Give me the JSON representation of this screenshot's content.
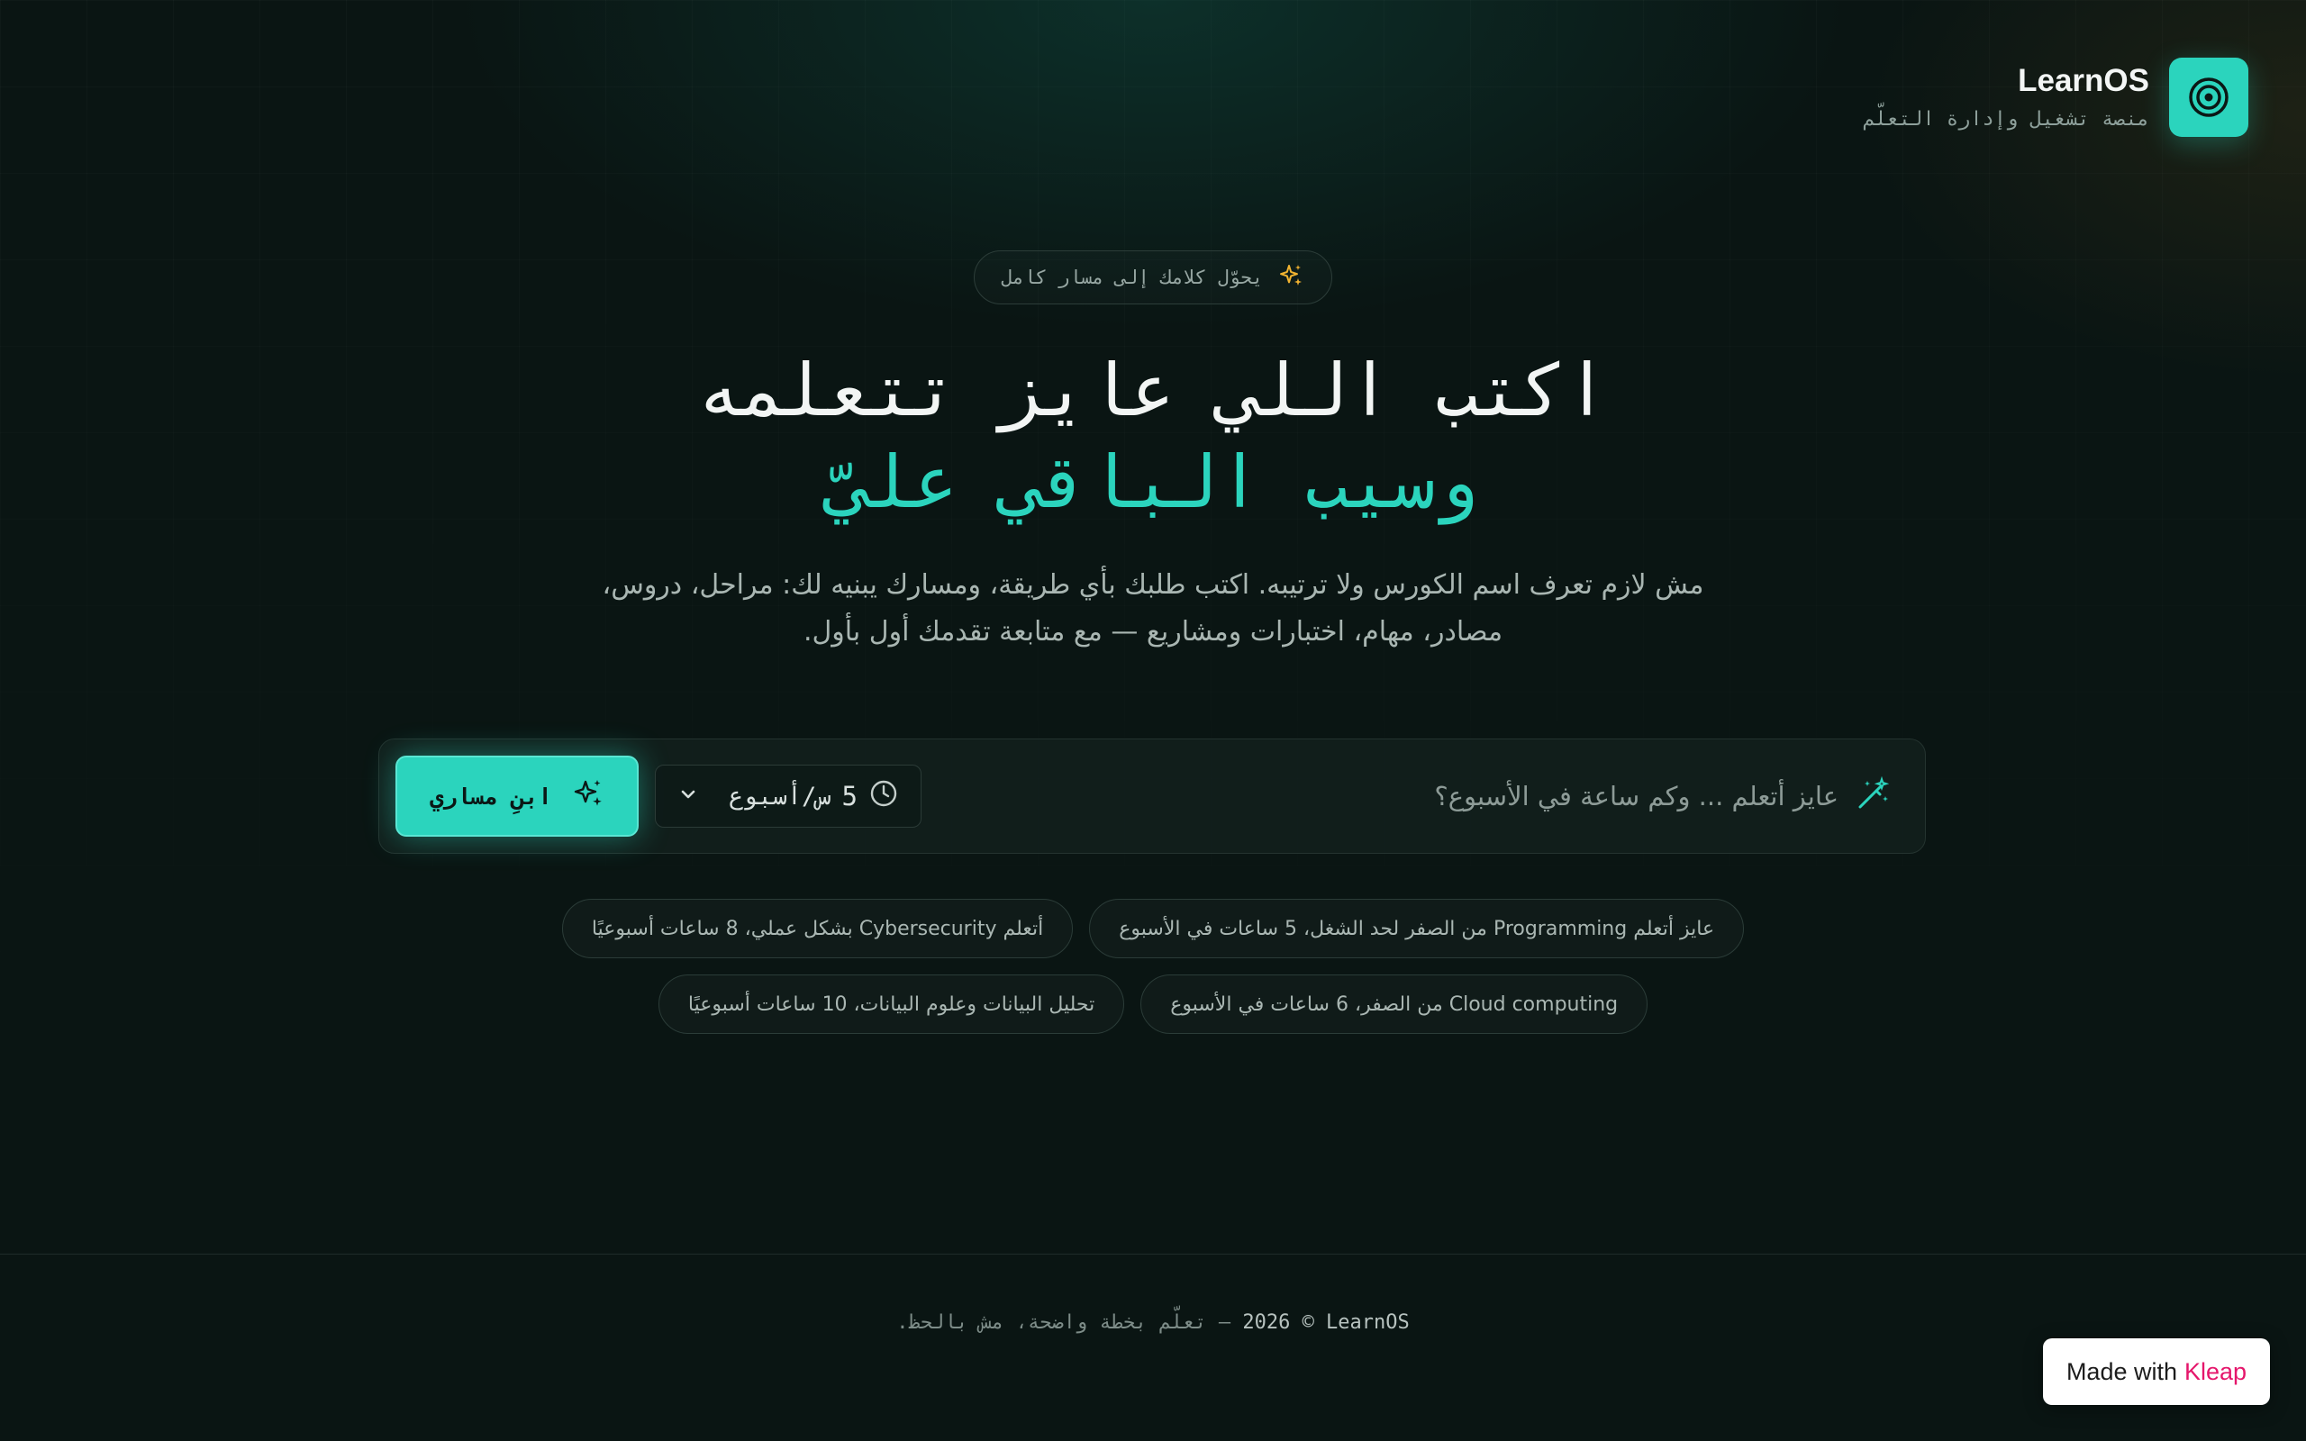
{
  "colors": {
    "accent": "#2bd4bd",
    "background": "#0a1513",
    "kleap": "#e5166b",
    "sparkle": "#f2b431"
  },
  "brand": {
    "name": "LearnOS",
    "tagline": "منصة تشغيل وإدارة التعلّم",
    "logo_icon": "target-icon"
  },
  "hero": {
    "pill_text": "يحوّل كلامك إلى مسار كامل",
    "pill_icon": "sparkles-icon",
    "headline_line1": "اكتب اللي عايز تتعلمه",
    "headline_line2": "وسيب الباقي عليّ",
    "description": "مش لازم تعرف اسم الكورس ولا ترتيبه. اكتب طلبك بأي طريقة، ومسارك يبنيه لك: مراحل، دروس، مصادر، مهام، اختبارات ومشاريع — مع متابعة تقدمك أول بأول."
  },
  "composer": {
    "input_icon": "magic-wand-icon",
    "placeholder": "عايز أتعلم ... وكم ساعة في الأسبوع؟",
    "hours_value": "5",
    "hours_unit": "س/أسبوع",
    "hours_icon": "clock-icon",
    "build_button_label": "ابنِ مساري",
    "build_button_icon": "sparkles-icon"
  },
  "suggestions": {
    "row1": [
      "عايز أتعلم Programming من الصفر لحد الشغل، 5 ساعات في الأسبوع",
      "أتعلم Cybersecurity بشكل عملي، 8 ساعات أسبوعيًا"
    ],
    "row2": [
      "Cloud computing من الصفر، 6 ساعات في الأسبوع",
      "تحليل البيانات وعلوم البيانات، 10 ساعات أسبوعيًا"
    ]
  },
  "footer": {
    "copyright": "2026 © LearnOS",
    "dash": "—",
    "slogan": "تعلّم بخطة واضحة، مش بالحظ."
  },
  "badge": {
    "made_with": "Made with",
    "kleap": "Kleap"
  }
}
